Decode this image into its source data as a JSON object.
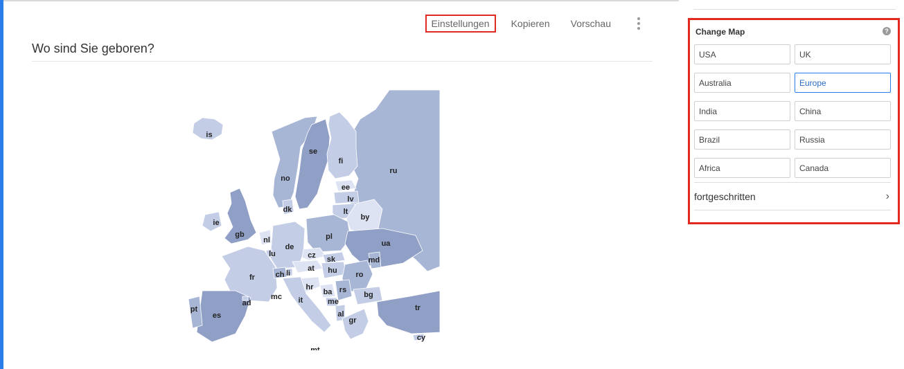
{
  "toolbar": {
    "settings_label": "Einstellungen",
    "copy_label": "Kopieren",
    "preview_label": "Vorschau"
  },
  "question": {
    "title": "Wo sind Sie geboren?"
  },
  "map": {
    "labels": [
      "is",
      "se",
      "fi",
      "no",
      "ru",
      "ee",
      "lv",
      "dk",
      "lt",
      "by",
      "ie",
      "gb",
      "nl",
      "de",
      "pl",
      "ua",
      "lu",
      "cz",
      "sk",
      "md",
      "fr",
      "ch",
      "li",
      "at",
      "hu",
      "ro",
      "hr",
      "ba",
      "rs",
      "bg",
      "it",
      "mc",
      "me",
      "ad",
      "pt",
      "es",
      "al",
      "gr",
      "tr",
      "cy",
      "mt"
    ],
    "colors": {
      "dark": "#8f9fc6",
      "mid": "#a8b6d6",
      "light": "#c3cde6",
      "lighter": "#dde3f2"
    }
  },
  "panel": {
    "title": "Change Map",
    "help_icon": "question-circle-icon",
    "options": [
      "USA",
      "UK",
      "Australia",
      "Europe",
      "India",
      "China",
      "Brazil",
      "Russia",
      "Africa",
      "Canada"
    ],
    "selected": "Europe",
    "advanced_label": "fortgeschritten",
    "advanced_icon": "chevron-right-icon"
  }
}
